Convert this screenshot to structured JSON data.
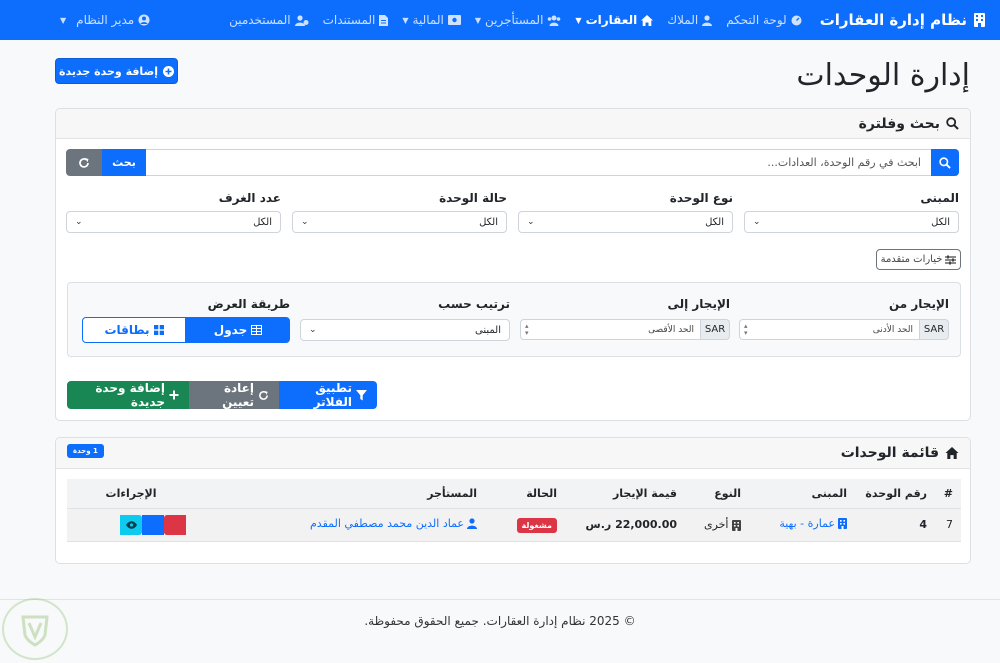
{
  "navbar": {
    "brand": "نظام إدارة العقارات",
    "items": [
      {
        "label": "لوحة التحكم",
        "icon": "dashboard-icon",
        "active": false
      },
      {
        "label": "الملاك",
        "icon": "user-icon",
        "active": false
      },
      {
        "label": "العقارات",
        "icon": "home-icon",
        "active": true,
        "dropdown": true
      },
      {
        "label": "المستأجرين",
        "icon": "users-icon",
        "dropdown": true
      },
      {
        "label": "المالية",
        "icon": "money-icon",
        "dropdown": true
      },
      {
        "label": "المستندات",
        "icon": "file-icon"
      },
      {
        "label": "المستخدمين",
        "icon": "users-cog-icon"
      }
    ],
    "user": "مدير النظام"
  },
  "page": {
    "title": "إدارة الوحدات",
    "add_button": "إضافة وحدة جديدة"
  },
  "filter": {
    "header": "بحث وفلترة",
    "search_placeholder": "ابحث في رقم الوحدة، العدادات...",
    "search_button": "بحث",
    "fields": [
      {
        "label": "المبنى",
        "value": "الكل"
      },
      {
        "label": "نوع الوحدة",
        "value": "الكل"
      },
      {
        "label": "حالة الوحدة",
        "value": "الكل"
      },
      {
        "label": "عدد الغرف",
        "value": "الكل"
      }
    ],
    "advanced_button": "خيارات متقدمة",
    "advanced": {
      "rent_from_label": "الإيجار من",
      "rent_from_placeholder": "الحد الأدنى",
      "rent_to_label": "الإيجار إلى",
      "rent_to_placeholder": "الحد الأقصى",
      "currency": "SAR",
      "sort_label": "ترتيب حسب",
      "sort_value": "المبنى",
      "view_label": "طريقة العرض",
      "view_table": "جدول",
      "view_cards": "بطاقات"
    },
    "apply_button": "تطبيق الفلاتر",
    "reset_button": "إعادة تعيين",
    "add_button": "إضافة وحدة جديدة"
  },
  "list": {
    "header": "قائمة الوحدات",
    "count_badge": "1 وحدة",
    "columns": [
      "#",
      "رقم الوحدة",
      "المبنى",
      "النوع",
      "قيمة الإيجار",
      "الحالة",
      "المستأجر",
      "الإجراءات"
    ],
    "rows": [
      {
        "index": "7",
        "unit_number": "4",
        "building": "عمارة - بهية",
        "type": "أخرى",
        "rent": "22,000.00 ر.س",
        "status": "مشغولة",
        "tenant": "عماد الدين محمد مصطفي المقدم"
      }
    ]
  },
  "footer": {
    "text": "© 2025 نظام إدارة العقارات. جميع الحقوق محفوظة."
  },
  "colors": {
    "primary": "#0d6efd",
    "secondary": "#6c757d",
    "success": "#198754",
    "danger": "#dc3545",
    "info": "#0dcaf0"
  }
}
